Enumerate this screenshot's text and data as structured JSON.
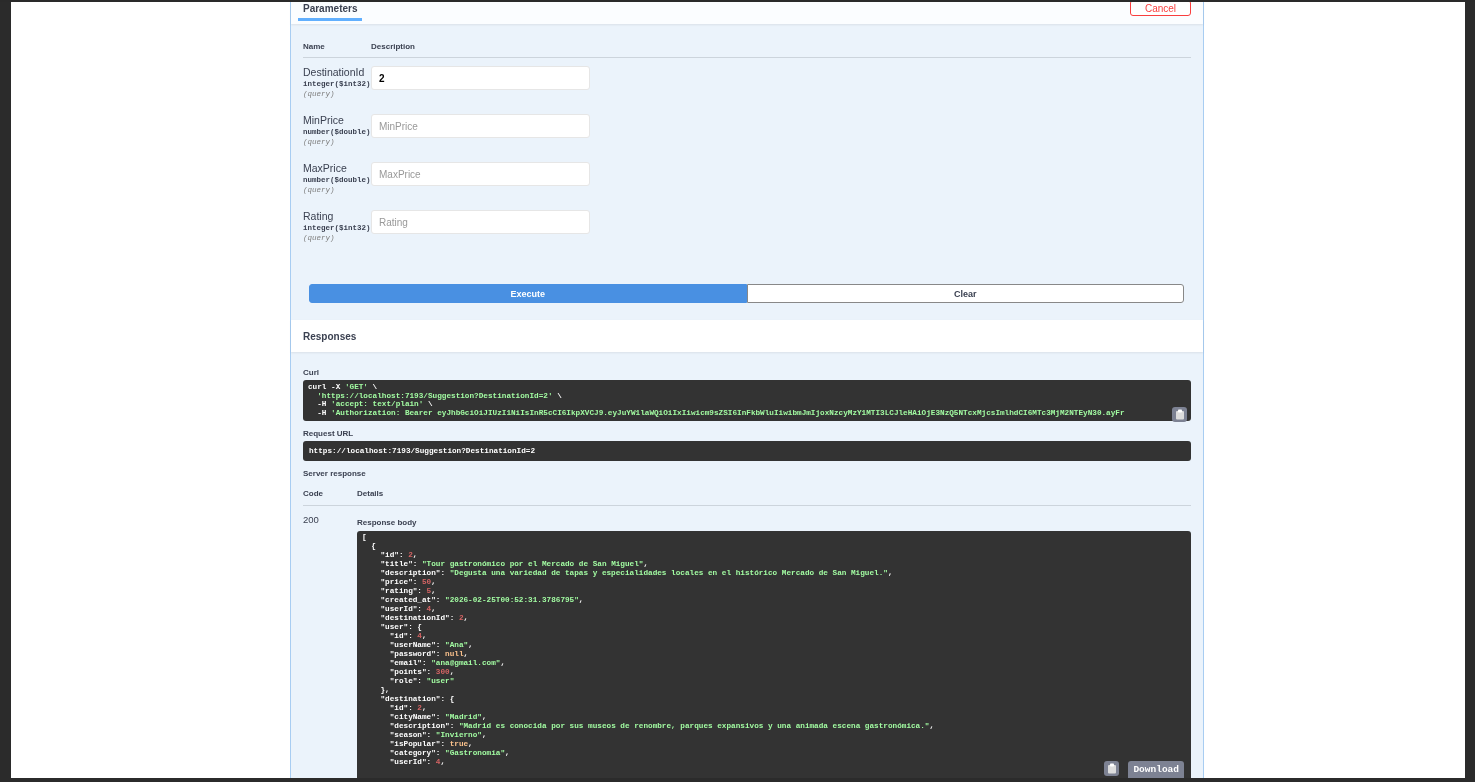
{
  "tabs": [
    {
      "label": "Parameters",
      "selected": true
    }
  ],
  "cancel_button": "Cancel",
  "parameters": {
    "columns": [
      "Name",
      "Description"
    ],
    "rows": [
      {
        "name": "DestinationId",
        "type": "integer($int32)",
        "location": "(query)",
        "value": "2"
      },
      {
        "name": "MinPrice",
        "type": "number($double)",
        "location": "(query)",
        "placeholder": "MinPrice"
      },
      {
        "name": "MaxPrice",
        "type": "number($double)",
        "location": "(query)",
        "placeholder": "MaxPrice"
      },
      {
        "name": "Rating",
        "type": "integer($int32)",
        "location": "(query)",
        "placeholder": "Rating"
      }
    ]
  },
  "execute_button": "Execute",
  "clear_button": "Clear",
  "responses": {
    "title": "Responses",
    "curl": {
      "label": "Curl",
      "lines": [
        "curl -X 'GET' \\",
        "  'https://localhost:7193/Suggestion?DestinationId=2' \\",
        "  -H 'accept: text/plain' \\",
        "  -H 'Authorization: Bearer eyJhbGciOiJIUzI1NiIsInR5cCI6IkpXVCJ9.eyJuYW1laWQiOiIxIiwicm9sZSI6InFkbWluIiwibmJmIjoxNzcyMzY1MTI3LCJleHAiOjE3NzQ5NTcxMjcsImlhdCI6MTc3MjM2NTEyN30.ayFr"
      ]
    },
    "request_url": {
      "label": "Request URL",
      "value": "https://localhost:7193/Suggestion?DestinationId=2"
    },
    "server_response": {
      "label": "Server response",
      "columns": [
        "Code",
        "Details"
      ],
      "rows": [
        {
          "code": "200",
          "body_label": "Response body",
          "download_button": "Download",
          "lines": [
            "[",
            "  {",
            "    \"id\": 2,",
            "    \"title\": \"Tour gastronómico por el Mercado de San Miguel\",",
            "    \"description\": \"Degusta una variedad de tapas y especialidades locales en el histórico Mercado de San Miguel.\",",
            "    \"price\": 50,",
            "    \"rating\": 5,",
            "    \"created_at\": \"2026-02-25T00:52:31.3786795\",",
            "    \"userId\": 4,",
            "    \"destinationId\": 2,",
            "    \"user\": {",
            "      \"id\": 4,",
            "      \"userName\": \"Ana\",",
            "      \"password\": null,",
            "      \"email\": \"ana@gmail.com\",",
            "      \"points\": 300,",
            "      \"role\": \"user\"",
            "    },",
            "    \"destination\": {",
            "      \"id\": 2,",
            "      \"cityName\": \"Madrid\",",
            "      \"description\": \"Madrid es conocida por sus museos de renombre, parques expansivos y una animada escena gastronómica.\",",
            "      \"season\": \"Invierno\",",
            "      \"isPopular\": true,",
            "      \"category\": \"Gastronomía\",",
            "      \"userId\": 4,"
          ]
        }
      ]
    }
  }
}
